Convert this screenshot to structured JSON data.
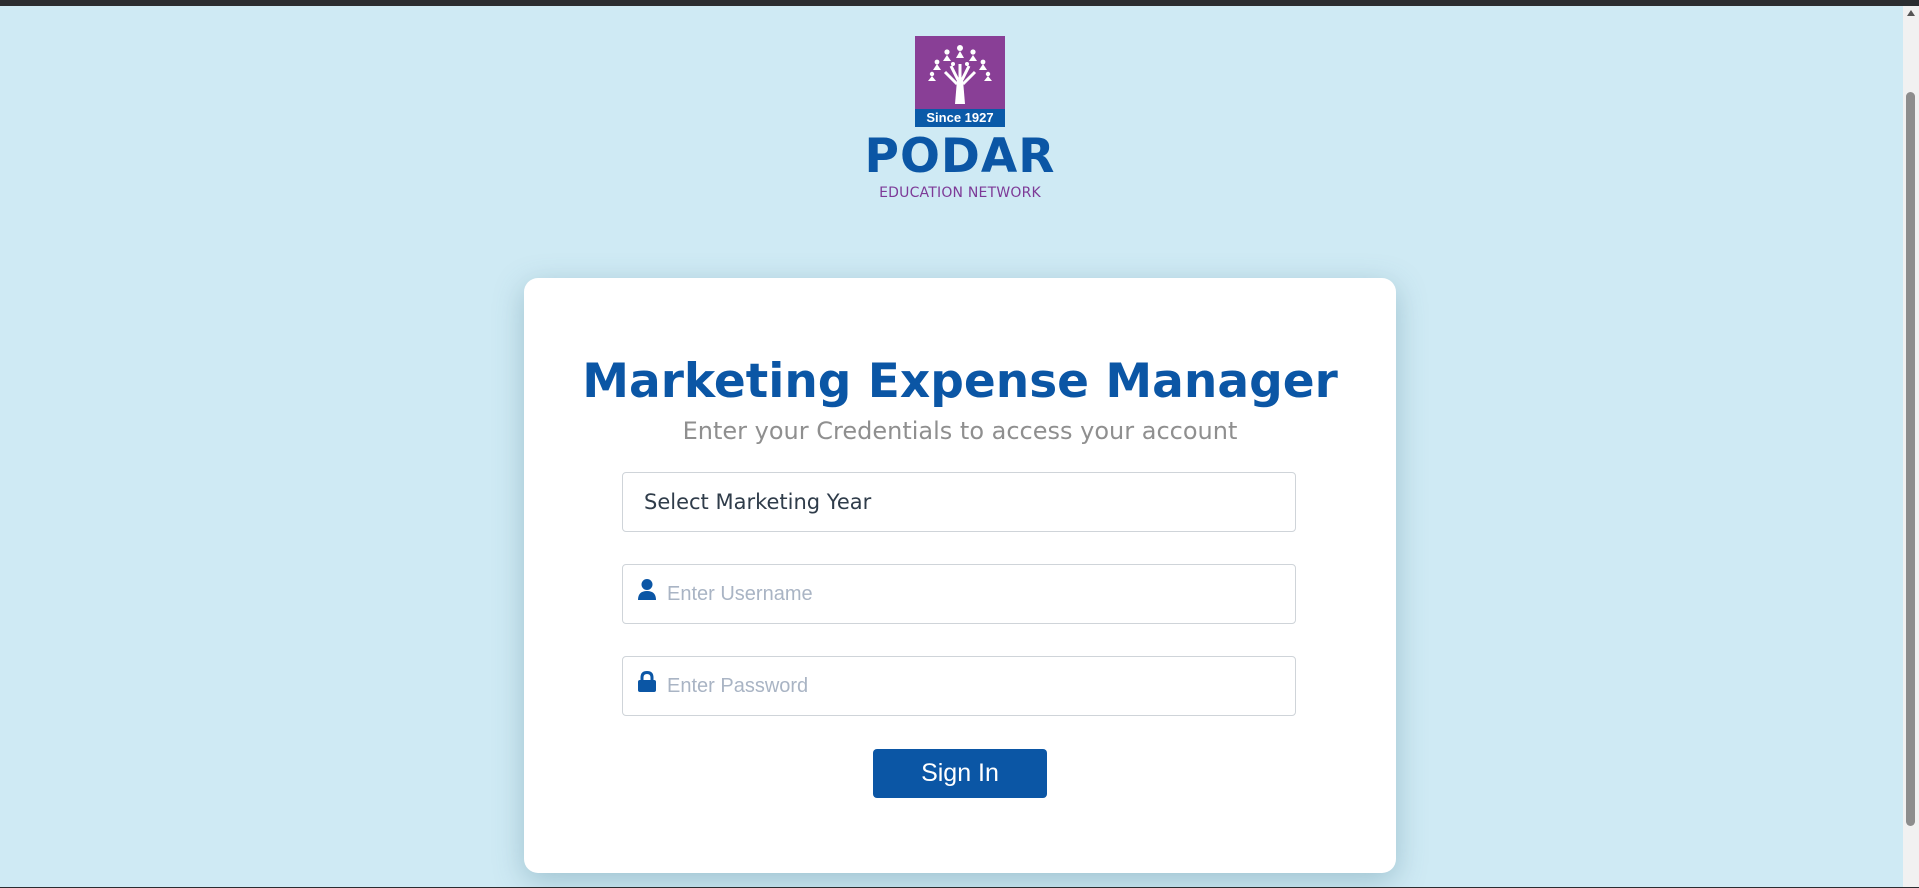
{
  "logo": {
    "since": "Since 1927",
    "name": "PODAR",
    "tagline": "EDUCATION NETWORK",
    "colors": {
      "purple": "#893f96",
      "blue": "#0b56a5"
    }
  },
  "card": {
    "title": "Marketing Expense Manager",
    "subtitle": "Enter your Credentials to access your account"
  },
  "form": {
    "year_select": {
      "label": "Select Marketing Year"
    },
    "username": {
      "placeholder": "Enter Username",
      "icon": "user-icon"
    },
    "password": {
      "placeholder": "Enter Password",
      "icon": "lock-icon"
    },
    "submit_label": "Sign In"
  },
  "colors": {
    "background": "#cfeaf4",
    "accent": "#0b56a5",
    "subtitle": "#8f8f8f"
  }
}
